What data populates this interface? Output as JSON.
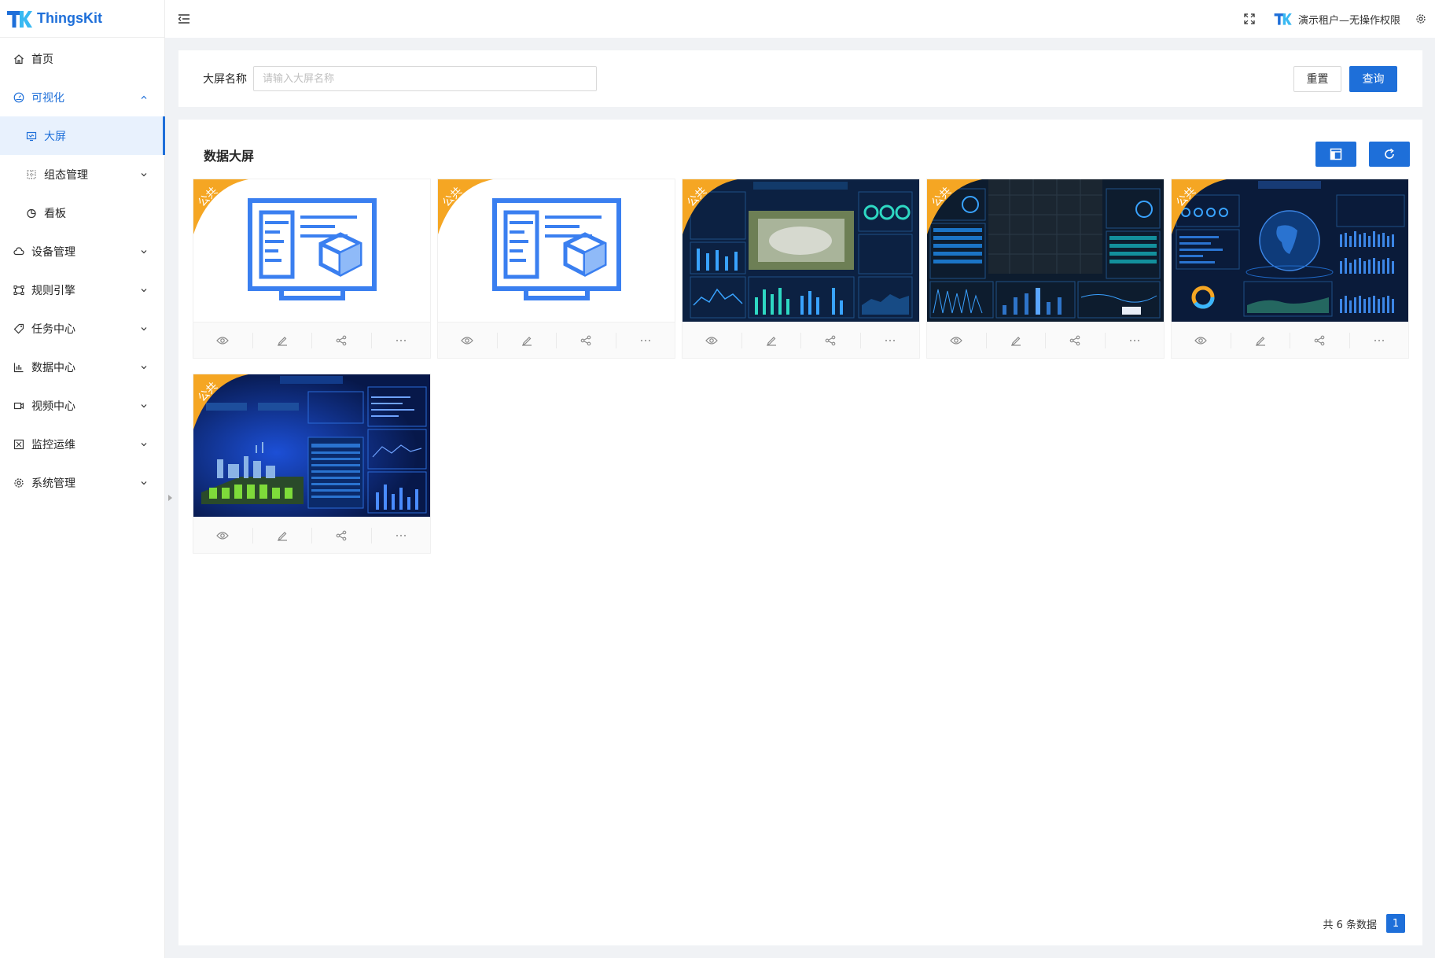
{
  "app": {
    "name": "ThingsKit"
  },
  "header": {
    "tenant_name": "演示租户—无操作权限"
  },
  "sidebar": {
    "items": [
      {
        "label": "首页",
        "icon": "home-icon"
      },
      {
        "label": "可视化",
        "icon": "dashboard-icon",
        "expanded": true
      },
      {
        "label": "大屏",
        "icon": "screen-icon",
        "active": true
      },
      {
        "label": "组态管理",
        "icon": "grid-icon"
      },
      {
        "label": "看板",
        "icon": "pie-icon"
      },
      {
        "label": "设备管理",
        "icon": "cloud-icon"
      },
      {
        "label": "规则引擎",
        "icon": "rule-icon"
      },
      {
        "label": "任务中心",
        "icon": "tag-icon"
      },
      {
        "label": "数据中心",
        "icon": "chart-icon"
      },
      {
        "label": "视频中心",
        "icon": "video-icon"
      },
      {
        "label": "监控运维",
        "icon": "monitor-icon"
      },
      {
        "label": "系统管理",
        "icon": "settings-icon"
      }
    ]
  },
  "search": {
    "label": "大屏名称",
    "value": "",
    "placeholder": "请输入大屏名称",
    "reset_label": "重置",
    "query_label": "查询"
  },
  "main": {
    "title": "数据大屏",
    "cards": [
      {
        "badge": "公共",
        "thumb": "placeholder"
      },
      {
        "badge": "公共",
        "thumb": "placeholder"
      },
      {
        "badge": "公共",
        "thumb": "park-dashboard"
      },
      {
        "badge": "公共",
        "thumb": "city-dashboard"
      },
      {
        "badge": "公共",
        "thumb": "globe-dashboard"
      },
      {
        "badge": "公共",
        "thumb": "factory-dashboard"
      }
    ]
  },
  "footer": {
    "total_text": "共 6 条数据",
    "current_page": "1"
  },
  "colors": {
    "primary": "#1e6fd9",
    "ribbon": "#f5a623",
    "thumb_dark": "#0b1f3d"
  }
}
